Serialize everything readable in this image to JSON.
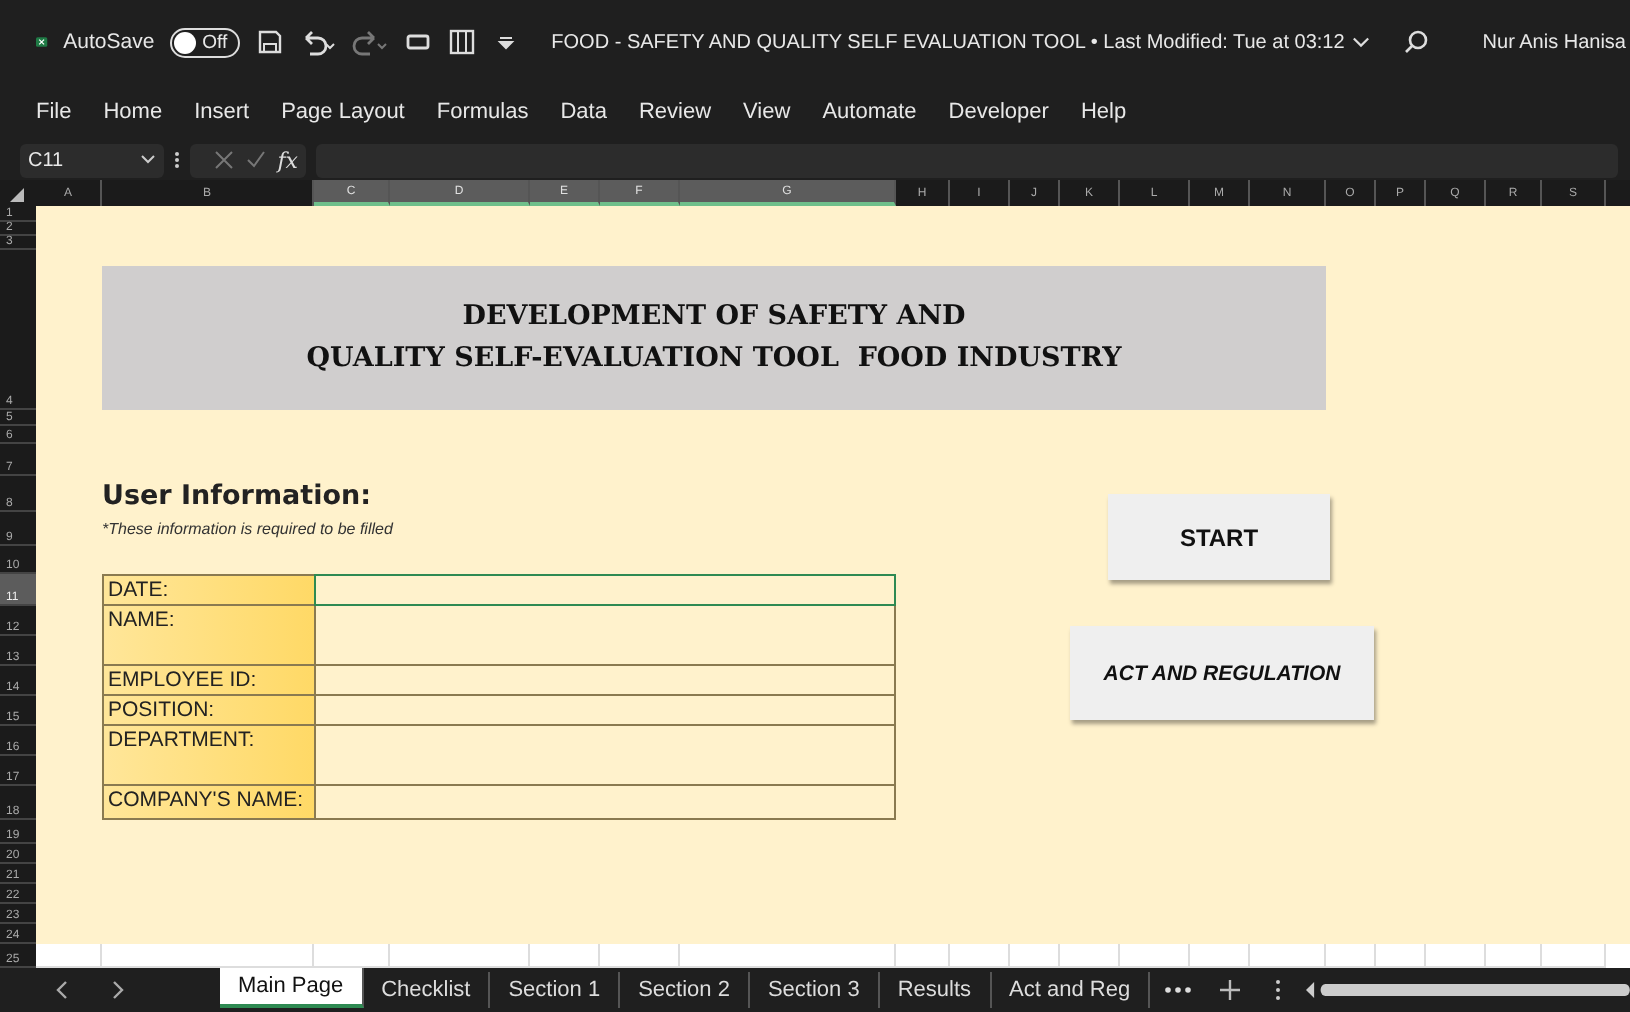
{
  "window": {
    "autosave_label": "AutoSave",
    "autosave": {
      "on": false,
      "label": "Off"
    },
    "title": "FOOD - SAFETY AND QUALITY SELF EVALUATION TOOL • Last Modified: Tue at 03:12",
    "user": "Nur Anis Hanisa"
  },
  "ribbon_tabs": [
    "File",
    "Home",
    "Insert",
    "Page Layout",
    "Formulas",
    "Data",
    "Review",
    "View",
    "Automate",
    "Developer",
    "Help"
  ],
  "formula_bar": {
    "name_box": "C11",
    "fx": "fx"
  },
  "columns": [
    {
      "label": "A",
      "selected": false
    },
    {
      "label": "B",
      "selected": false
    },
    {
      "label": "C",
      "selected": true
    },
    {
      "label": "D",
      "selected": true
    },
    {
      "label": "E",
      "selected": true
    },
    {
      "label": "F",
      "selected": true
    },
    {
      "label": "G",
      "selected": true
    },
    {
      "label": "H",
      "selected": false
    },
    {
      "label": "I",
      "selected": false
    },
    {
      "label": "J",
      "selected": false
    },
    {
      "label": "K",
      "selected": false
    },
    {
      "label": "L",
      "selected": false
    },
    {
      "label": "M",
      "selected": false
    },
    {
      "label": "N",
      "selected": false
    },
    {
      "label": "O",
      "selected": false
    },
    {
      "label": "P",
      "selected": false
    },
    {
      "label": "Q",
      "selected": false
    },
    {
      "label": "R",
      "selected": false
    },
    {
      "label": "S",
      "selected": false
    }
  ],
  "rows": [
    {
      "label": "1",
      "selected": false
    },
    {
      "label": "2",
      "selected": false
    },
    {
      "label": "3",
      "selected": false
    },
    {
      "label": "4",
      "selected": false
    },
    {
      "label": "5",
      "selected": false
    },
    {
      "label": "6",
      "selected": false
    },
    {
      "label": "7",
      "selected": false
    },
    {
      "label": "8",
      "selected": false
    },
    {
      "label": "9",
      "selected": false
    },
    {
      "label": "10",
      "selected": false
    },
    {
      "label": "11",
      "selected": true
    },
    {
      "label": "12",
      "selected": false
    },
    {
      "label": "13",
      "selected": false
    },
    {
      "label": "14",
      "selected": false
    },
    {
      "label": "15",
      "selected": false
    },
    {
      "label": "16",
      "selected": false
    },
    {
      "label": "17",
      "selected": false
    },
    {
      "label": "18",
      "selected": false
    },
    {
      "label": "19",
      "selected": false
    },
    {
      "label": "20",
      "selected": false
    },
    {
      "label": "21",
      "selected": false
    },
    {
      "label": "22",
      "selected": false
    },
    {
      "label": "23",
      "selected": false
    },
    {
      "label": "24",
      "selected": false
    },
    {
      "label": "25",
      "selected": false
    }
  ],
  "sheet": {
    "title_lines": [
      "DEVELOPMENT OF SAFETY AND",
      "QUALITY SELF-EVALUATION TOOL  FOOD INDUSTRY"
    ],
    "section_heading": "User Information:",
    "note": "*These information is required to be filled",
    "fields": [
      {
        "label": "DATE:",
        "kind": "short",
        "selected": true
      },
      {
        "label": "NAME:",
        "kind": "tall",
        "selected": false
      },
      {
        "label": "EMPLOYEE ID:",
        "kind": "short",
        "selected": false
      },
      {
        "label": "POSITION:",
        "kind": "short",
        "selected": false
      },
      {
        "label": "DEPARTMENT:",
        "kind": "tall",
        "selected": false
      },
      {
        "label": "COMPANY'S NAME:",
        "kind": "short",
        "selected": false
      }
    ],
    "buttons": [
      {
        "label": "START",
        "kind": "bold"
      },
      {
        "label": "ACT AND REGULATION",
        "kind": "italic"
      }
    ]
  },
  "sheet_tabs": [
    {
      "label": "Main Page",
      "selected": true
    },
    {
      "label": "Checklist",
      "selected": false
    },
    {
      "label": "Section 1",
      "selected": false
    },
    {
      "label": "Section 2",
      "selected": false
    },
    {
      "label": "Section 3",
      "selected": false
    },
    {
      "label": "Results",
      "selected": false
    },
    {
      "label": "Act and Reg",
      "selected": false
    }
  ]
}
